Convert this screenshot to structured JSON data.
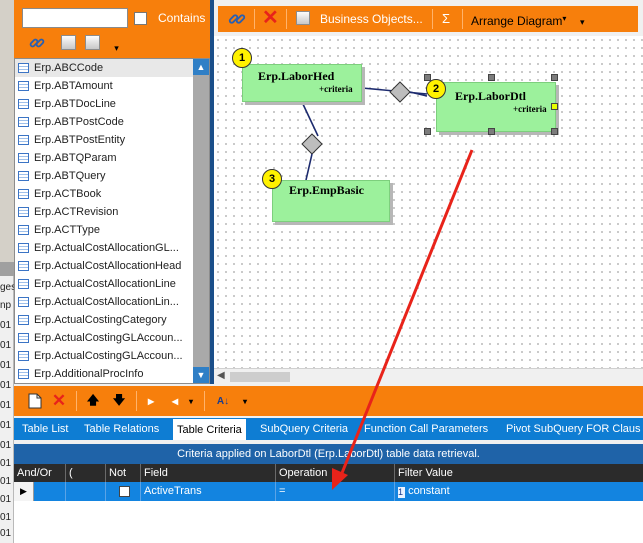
{
  "left_panel": {
    "contains_label": "Contains",
    "tables": [
      "Erp.ABCCode",
      "Erp.ABTAmount",
      "Erp.ABTDocLine",
      "Erp.ABTPostCode",
      "Erp.ABTPostEntity",
      "Erp.ABTQParam",
      "Erp.ABTQuery",
      "Erp.ACTBook",
      "Erp.ACTRevision",
      "Erp.ACTType",
      "Erp.ActualCostAllocationGL...",
      "Erp.ActualCostAllocationHead",
      "Erp.ActualCostAllocationLine",
      "Erp.ActualCostAllocationLin...",
      "Erp.ActualCostingCategory",
      "Erp.ActualCostingGLAccoun...",
      "Erp.ActualCostingGLAccoun...",
      "Erp.AdditionalProcInfo"
    ]
  },
  "behind_window": {
    "fragments": [
      "ges",
      "np",
      "01",
      "01",
      "01",
      "01",
      "01",
      "01",
      "01",
      "01",
      "01",
      "01",
      "01",
      "01",
      "01"
    ]
  },
  "diagram_toolbar": {
    "business_objects_label": "Business Objects...",
    "sigma_label": "Σ",
    "arrange_label": "Arrange Diagram"
  },
  "diagram": {
    "nodes": [
      {
        "num": "1",
        "name": "Erp.LaborHed",
        "criteria": "+criteria"
      },
      {
        "num": "2",
        "name": "Erp.LaborDtl",
        "criteria": "+criteria"
      },
      {
        "num": "3",
        "name": "Erp.EmpBasic",
        "criteria": ""
      }
    ]
  },
  "tabs": [
    "Table List",
    "Table Relations",
    "Table Criteria",
    "SubQuery Criteria",
    "Function Call Parameters",
    "Pivot SubQuery FOR Claus"
  ],
  "active_tab": "Table Criteria",
  "criteria_grid": {
    "caption": "Criteria applied on LaborDtl (Erp.LaborDtl) table data retrieval.",
    "columns": [
      "And/Or",
      "(",
      "Not",
      "Field",
      "Operation",
      "Filter Value"
    ],
    "row": {
      "and_or": "",
      "paren": "",
      "field": "ActiveTrans",
      "operation": "=",
      "filter_index": "1",
      "filter_value": "constant"
    }
  },
  "colors": {
    "toolbar_orange": "#f77f0c",
    "tab_blue": "#0e7dd3",
    "selected_row": "#1384e0",
    "node_green": "#9cf19c",
    "arrow_red": "#e8231a"
  }
}
